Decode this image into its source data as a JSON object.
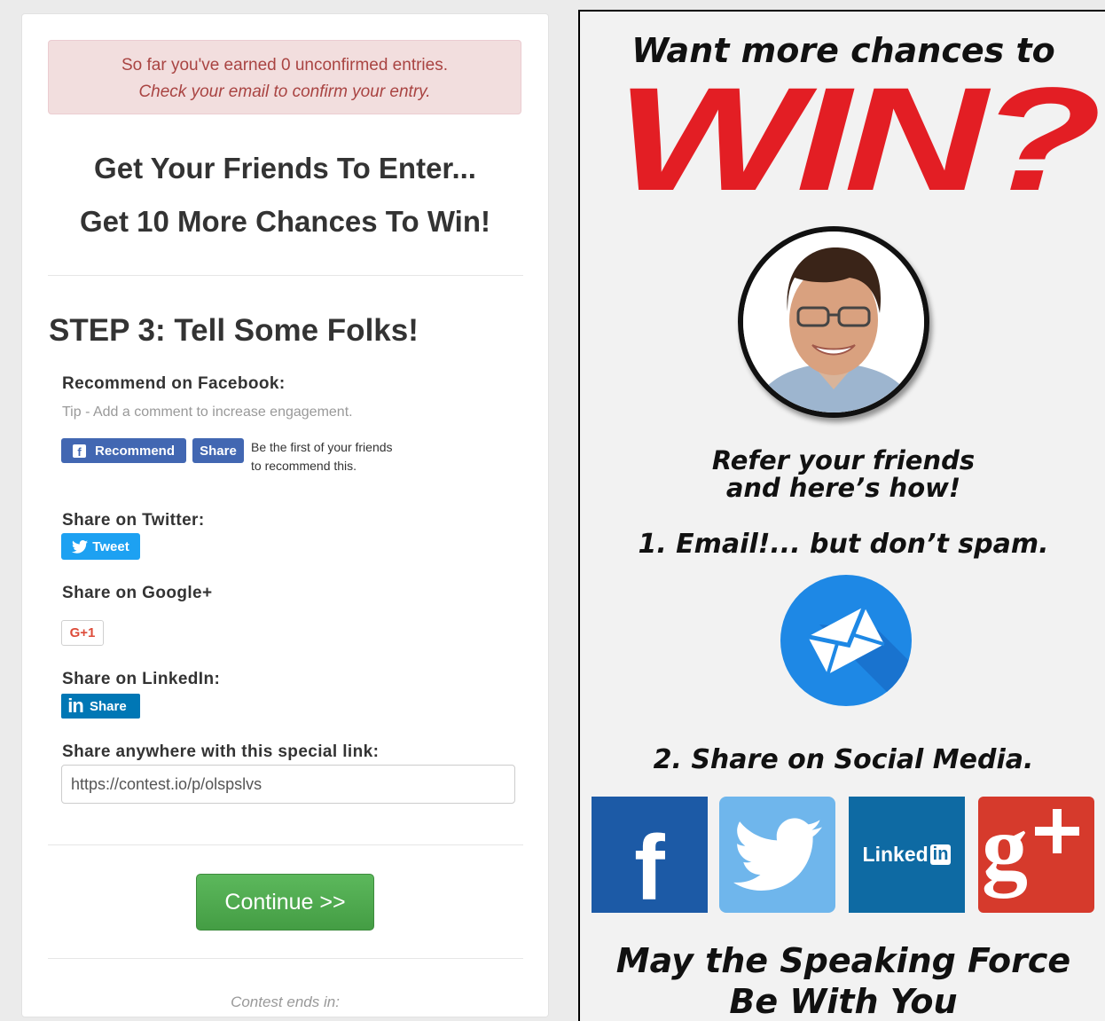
{
  "alert": {
    "line1": "So far you've earned 0 unconfirmed entries.",
    "line2": "Check your email to confirm your entry."
  },
  "headline": {
    "line1": "Get Your Friends To Enter...",
    "line2": "Get 10 More Chances To Win!"
  },
  "step": {
    "title": "STEP 3: Tell Some Folks!"
  },
  "facebook": {
    "label": "Recommend on Facebook:",
    "tip": "Tip - Add a comment to increase engagement.",
    "recommend_label": "Recommend",
    "share_label": "Share",
    "social_text": "Be the first of your friends to recommend this."
  },
  "twitter": {
    "label": "Share on Twitter:",
    "tweet_label": "Tweet"
  },
  "google": {
    "label": "Share on Google+",
    "button_label": "G+1"
  },
  "linkedin": {
    "label": "Share on LinkedIn:",
    "logo_text": "in",
    "share_label": "Share"
  },
  "special_link": {
    "label": "Share anywhere with this special link:",
    "value": "https://contest.io/p/olspslvs"
  },
  "continue_label": "Continue >>",
  "contest_ends": "Contest ends in:",
  "promo": {
    "top": "Want more chances to",
    "win": "WIN?",
    "refer_line1": "Refer your friends",
    "refer_line2": "and here’s how!",
    "step1": "1. Email!... but don’t spam.",
    "step2": "2. Share on Social Media.",
    "linkedin_tile_text": "Linked",
    "linkedin_tile_in": "in",
    "bottom_line1": "May the Speaking Force",
    "bottom_line2": "Be With You"
  },
  "colors": {
    "alert_bg": "#f2dede",
    "alert_text": "#a94442",
    "facebook": "#4267b2",
    "twitter": "#1da1f2",
    "linkedin": "#0077b5",
    "continue": "#5cb85c",
    "win_red": "#e31e24"
  }
}
